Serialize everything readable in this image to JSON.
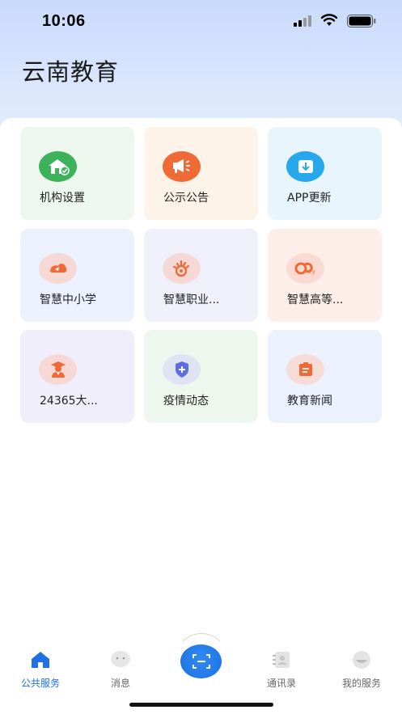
{
  "status_bar": {
    "time": "10:06"
  },
  "app": {
    "title": "云南教育"
  },
  "grid": {
    "items": [
      {
        "label": "机构设置",
        "icon": "institution-icon",
        "bg": "#eef7ef",
        "icon_bg": "#3cb25a"
      },
      {
        "label": "公示公告",
        "icon": "megaphone-icon",
        "bg": "#fdf3e8",
        "icon_bg": "#f06a35"
      },
      {
        "label": "APP更新",
        "icon": "download-icon",
        "bg": "#e9f5fd",
        "icon_bg": "#28a8ec"
      },
      {
        "label": "智慧中小学",
        "icon": "primary-school-icon",
        "bg": "#ebf1fd",
        "icon_bg": "#f6d9d4"
      },
      {
        "label": "智慧职业...",
        "icon": "vocational-icon",
        "bg": "#f0f0fb",
        "icon_bg": "#f6d9d4"
      },
      {
        "label": "智慧高等...",
        "icon": "higher-edu-icon",
        "bg": "#fdeee9",
        "icon_bg": "#fadbd3"
      },
      {
        "label": "24365大...",
        "icon": "graduate-icon",
        "bg": "#f0eefb",
        "icon_bg": "#f6d9d4"
      },
      {
        "label": "疫情动态",
        "icon": "shield-plus-icon",
        "bg": "#edf7ee",
        "icon_bg": "#dfe3f3"
      },
      {
        "label": "教育新闻",
        "icon": "news-icon",
        "bg": "#ebf1fd",
        "icon_bg": "#f6dcd6"
      }
    ]
  },
  "tabbar": {
    "tabs": [
      {
        "label": "公共服务",
        "active": true
      },
      {
        "label": "消息",
        "active": false
      },
      {
        "label": "通讯录",
        "active": false
      },
      {
        "label": "我的服务",
        "active": false
      }
    ]
  },
  "colors": {
    "accent": "#1f6fe5",
    "orange_icon": "#f06a35"
  }
}
